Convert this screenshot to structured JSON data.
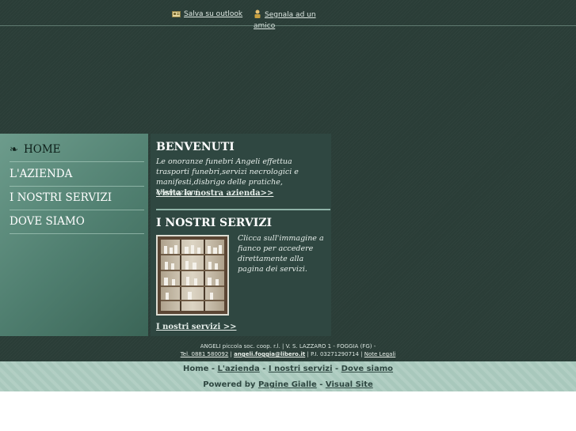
{
  "top_links": {
    "outlook": "Salva su outlook",
    "outlook_icon": "address-card-icon",
    "segnala": "Segnala ad un amico",
    "segnala_icon": "person-icon"
  },
  "sidebar": {
    "items": [
      {
        "label": "HOME",
        "icon": "swirl-icon",
        "active": true
      },
      {
        "label": "L'AZIENDA"
      },
      {
        "label": "I NOSTRI SERVIZI"
      },
      {
        "label": "DOVE SIAMO"
      }
    ]
  },
  "welcome": {
    "title": "BENVENUTI",
    "text": "Le onoranze funebri Angeli effettua trasporti funebri,servizi necrologici e manifesti,disbrigo delle pratiche, cremazioni,",
    "link": "Visita la nostra azienda>>"
  },
  "services": {
    "title": "I NOSTRI SERVIZI",
    "text": "Clicca sull'immagine a fianco per accedere direttamente alla pagina dei servizi.",
    "link": "I nostri servizi >>",
    "image": "showroom-shelves-photo"
  },
  "footer": {
    "line1": "ANGELI piccola soc. coop. r.l. | V. S. LAZZARO 1 - FOGGIA (FG) -",
    "phone": "Tel. 0881 580092",
    "email": "angeli.foggia@libero.it",
    "piva": "| P.I. 03271290714 |",
    "legal": "Note Legali"
  },
  "bottom_nav": {
    "home": "Home",
    "azienda": "L'azienda",
    "servizi": "I nostri servizi",
    "dove": "Dove siamo",
    "sep": " - "
  },
  "powered": {
    "label": "Powered by",
    "pagine": "Pagine Gialle",
    "sep": " - ",
    "visual": "Visual Site"
  },
  "colors": {
    "background": "#2a3d37",
    "sidebar": "#5e8e7e",
    "content": "#2f4741",
    "bottom_bar": "#a8c8bc"
  }
}
